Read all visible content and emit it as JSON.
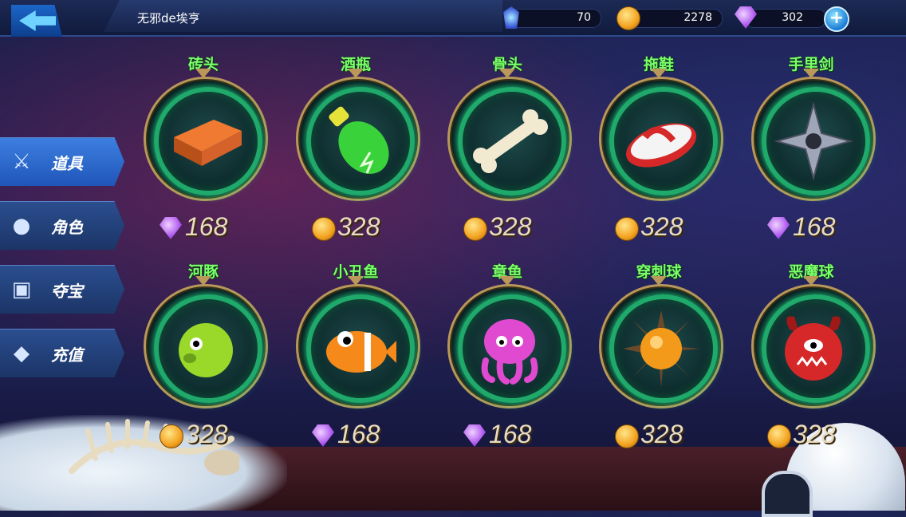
{
  "header": {
    "player_name": "无邪de埃亨",
    "resources": [
      {
        "icon": "energy-crystal-icon",
        "value": "70"
      },
      {
        "icon": "gold-coin-icon",
        "value": "2278"
      },
      {
        "icon": "purple-gem-icon",
        "value": "302"
      }
    ],
    "add_button": "+"
  },
  "sidebar": {
    "tabs": [
      {
        "label": "道具",
        "icon": "sword-icon",
        "active": true
      },
      {
        "label": "角色",
        "icon": "person-icon",
        "active": false
      },
      {
        "label": "夺宝",
        "icon": "treasure-chest-icon",
        "active": false
      },
      {
        "label": "充值",
        "icon": "diamond-icon",
        "active": false
      }
    ]
  },
  "shop": {
    "items": [
      {
        "name": "砖头",
        "price": "168",
        "currency": "gem",
        "art": "brick"
      },
      {
        "name": "酒瓶",
        "price": "328",
        "currency": "coin",
        "art": "bottle"
      },
      {
        "name": "骨头",
        "price": "328",
        "currency": "coin",
        "art": "bone"
      },
      {
        "name": "拖鞋",
        "price": "328",
        "currency": "coin",
        "art": "slipper"
      },
      {
        "name": "手里剑",
        "price": "168",
        "currency": "gem",
        "art": "shuriken"
      },
      {
        "name": "河豚",
        "price": "328",
        "currency": "coin",
        "art": "pufferfish"
      },
      {
        "name": "小丑鱼",
        "price": "168",
        "currency": "gem",
        "art": "clownfish"
      },
      {
        "name": "章鱼",
        "price": "168",
        "currency": "gem",
        "art": "octopus"
      },
      {
        "name": "穿刺球",
        "price": "328",
        "currency": "coin",
        "art": "spikeball"
      },
      {
        "name": "恶魔球",
        "price": "328",
        "currency": "coin",
        "art": "demonball"
      }
    ]
  },
  "colors": {
    "item_name": "#7cff6b",
    "ring_green": "#1fa96a",
    "ring_gold": "#b9985a",
    "side_active": "#3d7fe0"
  }
}
